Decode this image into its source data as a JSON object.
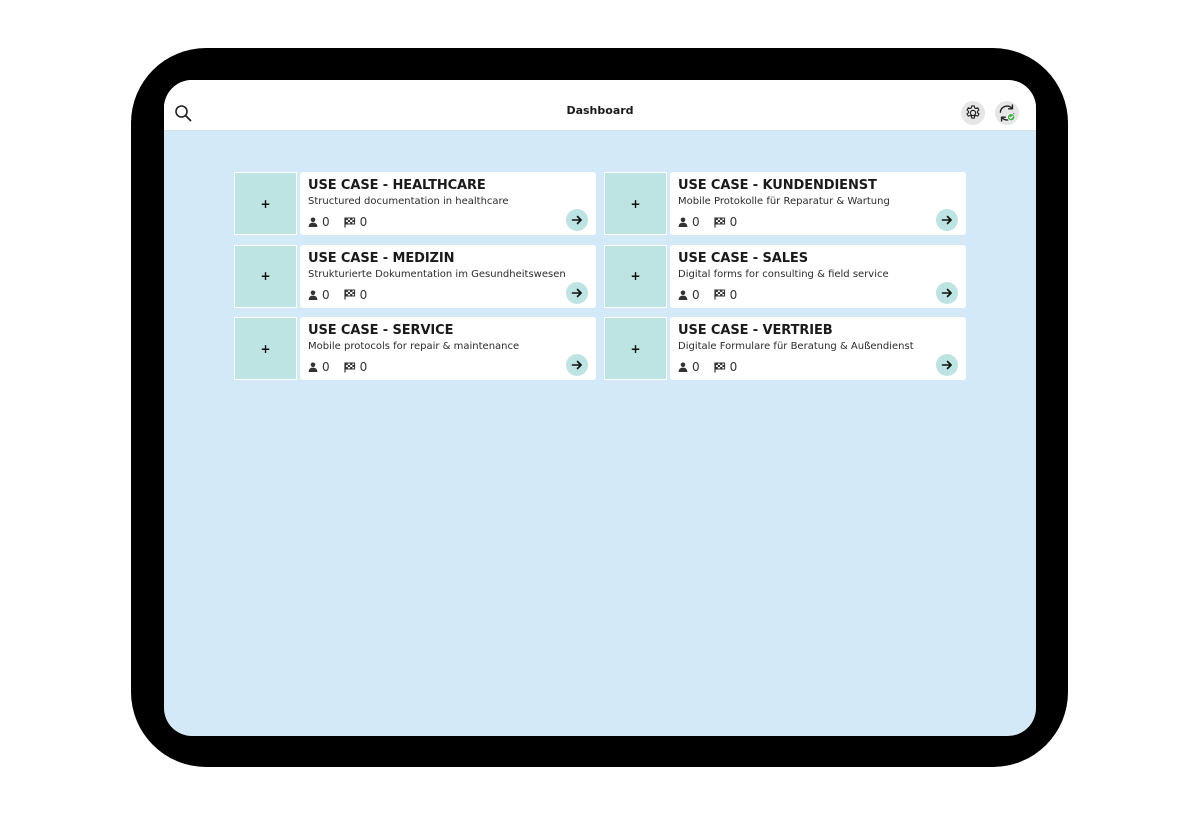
{
  "header": {
    "title": "Dashboard",
    "search_icon": "search-icon",
    "settings_icon": "gear-icon",
    "sync_icon": "sync-icon"
  },
  "colors": {
    "background": "#d4e9f8",
    "thumb": "#bde3e3",
    "card": "#ffffff",
    "sync_ok": "#4caf50"
  },
  "cards": [
    {
      "thumb_label": "+",
      "title": "USE CASE - HEALTHCARE",
      "description": "Structured documentation in healthcare",
      "users": "0",
      "flags": "0"
    },
    {
      "thumb_label": "+",
      "title": "USE CASE - KUNDENDIENST",
      "description": "Mobile Protokolle für Reparatur & Wartung",
      "users": "0",
      "flags": "0"
    },
    {
      "thumb_label": "+",
      "title": "USE CASE - MEDIZIN",
      "description": "Strukturierte Dokumentation im Gesundheitswesen",
      "users": "0",
      "flags": "0"
    },
    {
      "thumb_label": "+",
      "title": "USE CASE - SALES",
      "description": "Digital forms for consulting & field service",
      "users": "0",
      "flags": "0"
    },
    {
      "thumb_label": "+",
      "title": "USE CASE - SERVICE",
      "description": "Mobile protocols for repair & maintenance",
      "users": "0",
      "flags": "0"
    },
    {
      "thumb_label": "+",
      "title": "USE CASE - VERTRIEB",
      "description": "Digitale Formulare für Beratung & Außendienst",
      "users": "0",
      "flags": "0"
    }
  ]
}
